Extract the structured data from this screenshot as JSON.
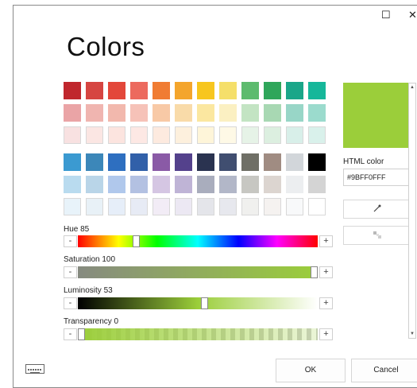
{
  "window": {
    "title": "Colors",
    "maximize_glyph": "☐",
    "close_glyph": "✕"
  },
  "palette": {
    "rows": [
      [
        "#c0272d",
        "#d64541",
        "#e3473a",
        "#ec6a5e",
        "#f07c33",
        "#f4a52c",
        "#f7c61e",
        "#f5df6a",
        "#5dbb6e",
        "#2fa65a",
        "#1aa689",
        "#16b79a"
      ],
      [
        "#eaa4a6",
        "#f0b5b0",
        "#f2b8ad",
        "#f6c2b8",
        "#f8c9a6",
        "#f9dba9",
        "#fbe7a0",
        "#fbf0c2",
        "#c3e4c3",
        "#a8d8b3",
        "#98d6c7",
        "#9bdbcd"
      ],
      [
        "#f8e1e1",
        "#fbe6e3",
        "#fce4df",
        "#fde8e4",
        "#fdeadf",
        "#fdf0dd",
        "#fef5d9",
        "#fef9e6",
        "#e6f3e7",
        "#dcefe0",
        "#d8efe9",
        "#d9f1eb"
      ],
      [
        "#3b9ad1",
        "#3c87b9",
        "#2e6fc0",
        "#3160a9",
        "#8a5aa6",
        "#54418c",
        "#2a3350",
        "#404e70",
        "#6f6f66",
        "#a08c82",
        "#d2d6da",
        "#000000"
      ],
      [
        "#b9dbef",
        "#b9d5e8",
        "#b0c8ec",
        "#b3c1e2",
        "#d5c6e3",
        "#bfb4d6",
        "#a9adbd",
        "#b2b7c8",
        "#c7c7c2",
        "#dcd5d0",
        "#eceef0",
        "#d4d4d4"
      ],
      [
        "#e8f3fa",
        "#e8f1f7",
        "#e6eef9",
        "#e7ebf5",
        "#f2ecf6",
        "#ece8f3",
        "#e4e5ea",
        "#e7e8ee",
        "#f0f0ee",
        "#f5f2f0",
        "#f8f9fa",
        "#ffffff"
      ]
    ]
  },
  "sliders": {
    "hue": {
      "label": "Hue 85",
      "value": 85,
      "max": 360
    },
    "saturation": {
      "label": "Saturation 100",
      "value": 100,
      "max": 100
    },
    "luminosity": {
      "label": "Luminosity 53",
      "value": 53,
      "max": 100
    },
    "transparency": {
      "label": "Transparency 0",
      "value": 0,
      "max": 100
    },
    "minus_label": "-",
    "plus_label": "+"
  },
  "preview": {
    "color": "#9BCE3A"
  },
  "html_color": {
    "label": "HTML color",
    "value": "#9BFF0FFF"
  },
  "tools": {
    "eyedropper_icon": "eyedropper-icon",
    "blur_icon": "pixel-icon"
  },
  "footer": {
    "ok_label": "OK",
    "cancel_label": "Cancel",
    "keyboard_icon": "keyboard-icon"
  }
}
